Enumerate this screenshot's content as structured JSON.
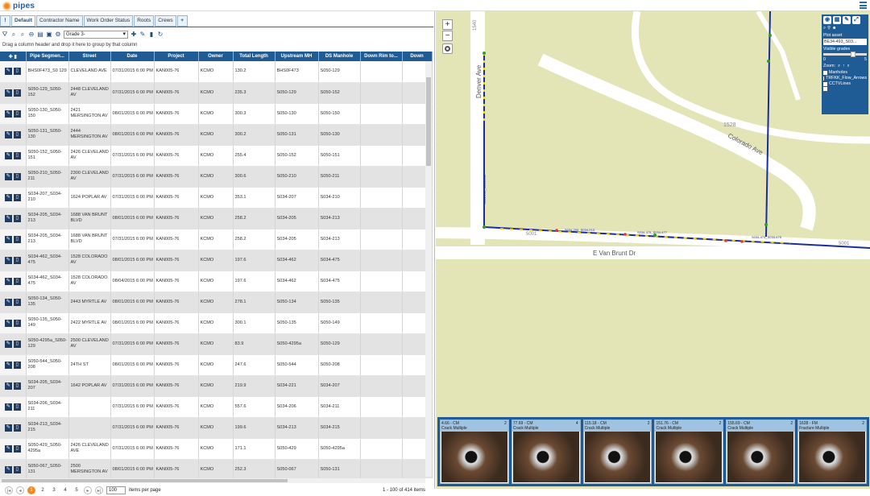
{
  "app": {
    "name": "pipes"
  },
  "tabs": [
    {
      "label": "!",
      "icon": "alert-icon"
    },
    {
      "label": "Default"
    },
    {
      "label": "Contractor Name"
    },
    {
      "label": "Work Order Status"
    },
    {
      "label": "Roots"
    },
    {
      "label": "Crews"
    },
    {
      "label": "+",
      "icon": "add-tab-icon"
    }
  ],
  "toolbar": {
    "grade_select": "Grade 3-"
  },
  "grid": {
    "group_hint": "Drag a column header and drop it here to group by that column",
    "columns": [
      "",
      "Pipe Segmen...",
      "Street",
      "Date",
      "Project",
      "Owner",
      "Total Length",
      "Upstream MH",
      "DS Manhole",
      "Down Rim to...",
      "Down"
    ],
    "rows": [
      [
        "BHS0F473_S0 129",
        "CLEVELAND AVE",
        "07/31/2015 6:00 PM",
        "KAN005-76",
        "KCMO",
        "130.2",
        "BHS0F473",
        "S050-129"
      ],
      [
        "S050-129_S050-152",
        "2448 CLEVELAND AV",
        "07/31/2015 6:00 PM",
        "KAN005-76",
        "KCMO",
        "235.3",
        "S050-129",
        "S050-152"
      ],
      [
        "S050-130_S050-150",
        "2421 MERSINGTON AV",
        "08/01/2015 6:00 PM",
        "KAN005-76",
        "KCMO",
        "300.3",
        "S050-130",
        "S050-150"
      ],
      [
        "S050-131_S050-130",
        "2444 MERSINGTON AV",
        "08/01/2015 6:00 PM",
        "KAN005-76",
        "KCMO",
        "300.2",
        "S050-131",
        "S050-130"
      ],
      [
        "S050-152_S050-151",
        "2426 CLEVELAND AV",
        "07/31/2015 6:00 PM",
        "KAN005-76",
        "KCMO",
        "255.4",
        "S050-152",
        "S050-151"
      ],
      [
        "S050-210_S050-211",
        "2300 CLEVELAND AV",
        "07/31/2015 6:00 PM",
        "KAN005-76",
        "KCMO",
        "300.6",
        "S050-210",
        "S050-211"
      ],
      [
        "S034-207_S034-210",
        "1624 POPLAR AV",
        "07/31/2015 6:00 PM",
        "KAN005-76",
        "KCMO",
        "353.1",
        "S034-207",
        "S034-210"
      ],
      [
        "S034-205_S034-213",
        "1688 VAN BRUNT BLVD",
        "08/01/2015 6:00 PM",
        "KAN005-76",
        "KCMO",
        "258.2",
        "S034-205",
        "S034-213"
      ],
      [
        "S034-205_S034-213",
        "1688 VAN BRUNT BLVD",
        "07/31/2015 6:00 PM",
        "KAN005-76",
        "KCMO",
        "258.2",
        "S034-205",
        "S034-213"
      ],
      [
        "S034-462_S034-475",
        "1528 COLORADO AV",
        "08/01/2015 6:00 PM",
        "KAN005-76",
        "KCMO",
        "197.6",
        "S034-462",
        "S034-475"
      ],
      [
        "S034-462_S034-475",
        "1528 COLORADO AV",
        "08/04/2015 6:00 PM",
        "KAN005-76",
        "KCMO",
        "197.6",
        "S034-462",
        "S034-475"
      ],
      [
        "S050-134_S050-135",
        "2443 MYRTLE AV",
        "08/01/2015 6:00 PM",
        "KAN005-76",
        "KCMO",
        "278.1",
        "S050-134",
        "S050-135"
      ],
      [
        "S050-135_S050-149",
        "2422 MYRTLE AV",
        "08/01/2015 6:00 PM",
        "KAN005-76",
        "KCMO",
        "300.1",
        "S050-135",
        "S050-149"
      ],
      [
        "S050-4295a_S050-129",
        "2500 CLEVELAND AV",
        "07/31/2015 6:00 PM",
        "KAN005-76",
        "KCMO",
        "83.9",
        "S050-4295a",
        "S050-129"
      ],
      [
        "S050-544_S050-208",
        "24TH ST",
        "08/01/2015 6:00 PM",
        "KAN005-76",
        "KCMO",
        "247.6",
        "S050-544",
        "S050-208"
      ],
      [
        "S034-205_S034-207",
        "1642 POPLAR AV",
        "07/31/2015 6:00 PM",
        "KAN005-76",
        "KCMO",
        "219.9",
        "S034-221",
        "S034-207"
      ],
      [
        "S034-206_S034-211",
        "",
        "07/31/2015 6:00 PM",
        "KAN005-76",
        "KCMO",
        "557.6",
        "S034-206",
        "S034-211"
      ],
      [
        "S034-213_S034-215",
        "",
        "07/31/2015 6:00 PM",
        "KAN005-76",
        "KCMO",
        "199.6",
        "S034-213",
        "S034-215"
      ],
      [
        "S050-429_S050-4295a",
        "2426 CLEVELAND AVE",
        "07/31/2015 6:00 PM",
        "KAN005-76",
        "KCMO",
        "171.1",
        "S050-429",
        "S050-4295a"
      ],
      [
        "S050-067_S050-131",
        "2500 MERSINGTON AV",
        "08/01/2015 6:00 PM",
        "KAN005-76",
        "KCMO",
        "252.3",
        "S050-067",
        "S050-131"
      ],
      [
        "S034-474_S034-475",
        "",
        "08/01/2015 6:00 PM",
        "KAN005-76",
        "KCMO",
        "207",
        "S034-474",
        "S034-475"
      ]
    ]
  },
  "pager": {
    "first": "|◂",
    "prev": "◂",
    "pages": [
      "1",
      "2",
      "3",
      "4",
      "5"
    ],
    "current": "1",
    "next": "▸",
    "last": "▸|",
    "per_page": "100",
    "per_page_label": "items per page",
    "info": "1 - 100 of 414 items"
  },
  "map": {
    "streets": [
      "Denver Ave",
      "Colorado Ave",
      "E Van Brunt Dr"
    ],
    "block_labels": [
      "1540",
      "1528",
      "5001",
      "5001"
    ],
    "pipe_labels": [
      "S034-213_S034-205",
      "S034-205_S034-213",
      "S034-475_S034-477",
      "S034-474_S034-475"
    ]
  },
  "layer_panel": {
    "plot_asset_label": "Plot asset",
    "plot_asset_value": "BE34-493_S03...",
    "visible_grades_label": "Visible grades",
    "grade_min": "0",
    "grade_max": "5",
    "zoom_label": "Zoom:",
    "layers": [
      {
        "label": "Manholes"
      },
      {
        "label": "TRFKK_Flow_Arrows"
      },
      {
        "label": "CCTVLines"
      },
      {
        "label": ""
      }
    ]
  },
  "thumbnails": [
    {
      "caption": "4.66 - CM",
      "sub": "Crack Multiple",
      "count": "2"
    },
    {
      "caption": "77.69 - CM",
      "sub": "Crack Multiple",
      "count": "4"
    },
    {
      "caption": "115.18 - CM",
      "sub": "Crack Multiple",
      "count": "2"
    },
    {
      "caption": "151.76 - CM",
      "sub": "Crack Multiple",
      "count": "2"
    },
    {
      "caption": "155.69 - CM",
      "sub": "Crack Multiple",
      "count": "2"
    },
    {
      "caption": "1628 - FM",
      "sub": "Fracture Multiple",
      "count": "2"
    }
  ]
}
